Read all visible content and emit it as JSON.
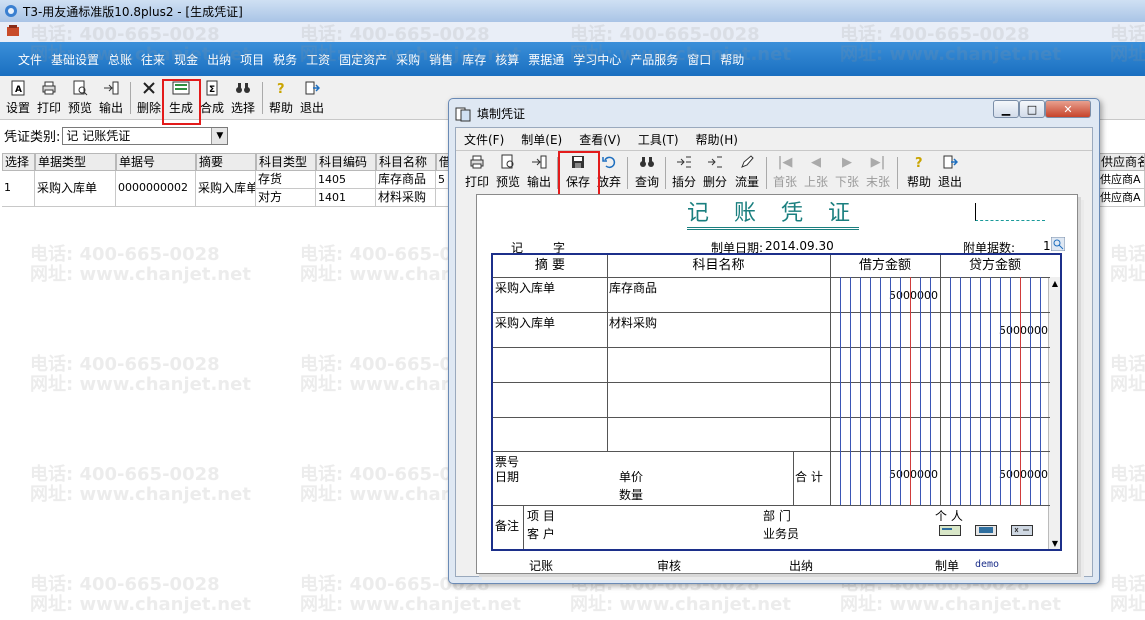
{
  "window": {
    "title": "T3-用友通标准版10.8plus2 - [生成凭证]"
  },
  "menubar": {
    "items": [
      "文件",
      "基础设置",
      "总账",
      "往来",
      "现金",
      "出纳",
      "项目",
      "税务",
      "工资",
      "固定资产",
      "采购",
      "销售",
      "库存",
      "核算",
      "票据通",
      "学习中心",
      "产品服务",
      "窗口",
      "帮助"
    ]
  },
  "toolbar": {
    "buttons": [
      "设置",
      "打印",
      "预览",
      "输出",
      "删除",
      "生成",
      "合成",
      "选择",
      "帮助",
      "退出"
    ]
  },
  "voucher_type": {
    "label": "凭证类别:",
    "value": "记 记账凭证"
  },
  "grid": {
    "headers": [
      "选择",
      "单据类型",
      "单据号",
      "摘要",
      "科目类型",
      "科目编码",
      "科目名称",
      "借",
      "供应商名"
    ],
    "row": {
      "select": "1",
      "doc_type": "采购入库单",
      "doc_no": "0000000002",
      "summary": "采购入库单",
      "lines": [
        {
          "subject_type": "存货",
          "code": "1405",
          "name": "库存商品",
          "debit": "5",
          "supplier": "供应商A"
        },
        {
          "subject_type": "对方",
          "code": "1401",
          "name": "材料采购",
          "debit": "",
          "supplier": "供应商A"
        }
      ]
    }
  },
  "dialog": {
    "title": "填制凭证",
    "menu": [
      "文件(F)",
      "制单(E)",
      "查看(V)",
      "工具(T)",
      "帮助(H)"
    ],
    "toolbar": {
      "buttons": [
        "打印",
        "预览",
        "输出",
        "保存",
        "放弃",
        "查询",
        "插分",
        "删分",
        "流量",
        "首张",
        "上张",
        "下张",
        "末张",
        "帮助",
        "退出"
      ]
    },
    "voucher": {
      "title": "记 账 凭 证",
      "type_label": "记",
      "zi_label": "字",
      "date_label": "制单日期:",
      "date": "2014.09.30",
      "attachments_label": "附单据数:",
      "attachments": "1",
      "col_summary": "摘 要",
      "col_subject": "科目名称",
      "col_debit": "借方金额",
      "col_credit": "贷方金额",
      "entries": [
        {
          "summary": "采购入库单",
          "subject": "库存商品",
          "debit": "5000000",
          "credit": ""
        },
        {
          "summary": "采购入库单",
          "subject": "材料采购",
          "debit": "",
          "credit": "5000000"
        }
      ],
      "ticket_no_label": "票号",
      "date_row_label": "日期",
      "unit_price_label": "单价",
      "quantity_label": "数量",
      "total_label": "合 计",
      "total_debit": "5000000",
      "total_credit": "5000000",
      "remark_label": "备注",
      "project_label": "项 目",
      "customer_label": "客 户",
      "department_label": "部 门",
      "salesperson_label": "业务员",
      "person_label": "个 人",
      "sign_bookkeeper": "记账",
      "sign_review": "审核",
      "sign_cashier": "出纳",
      "sign_maker": "制单",
      "maker_name": "demo"
    }
  },
  "watermark": {
    "phone": "电话: 400-665-0028",
    "site": "网址: www.chanjet.net"
  }
}
